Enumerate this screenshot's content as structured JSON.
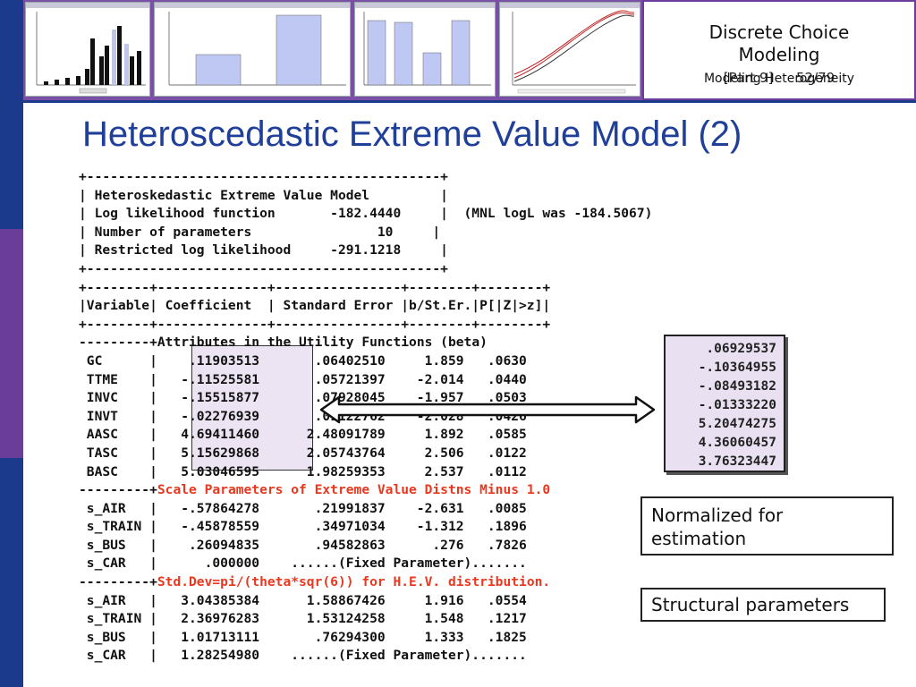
{
  "colors": {
    "sidebar_blue": "#1c3a8c",
    "sidebar_purple": "#6a3d9a",
    "band_purple": "#7a4fa5",
    "title_blue": "#1f3f99",
    "highlight_red": "#e8381f",
    "box_fill": "#e9e1f1"
  },
  "header": {
    "course_title_line1": "Discrete Choice",
    "course_title_line2": "Modeling",
    "part_label": "[Part 9]",
    "page": "52/79",
    "subtitle": "Modeling Heterogeneity"
  },
  "slide": {
    "title": "Heteroscedastic Extreme Value Model (2)"
  },
  "output_lines": [
    {
      "text": "+---------------------------------------------+"
    },
    {
      "text": "| Heteroskedastic Extreme Value Model         |"
    },
    {
      "text": "| Log likelihood function       -182.4440     |  (MNL logL was -184.5067)"
    },
    {
      "text": "| Number of parameters                10     |"
    },
    {
      "text": "| Restricted log likelihood     -291.1218     |"
    },
    {
      "text": "+---------------------------------------------+"
    },
    {
      "text": "+--------+--------------+----------------+--------+--------+"
    },
    {
      "text": "|Variable| Coefficient  | Standard Error |b/St.Er.|P[|Z|>z]|"
    },
    {
      "text": "+--------+--------------+----------------+--------+--------+"
    },
    {
      "prefix": "---------+",
      "text": "Attributes in the Utility Functions (beta)"
    },
    {
      "text": " GC      |    .11903513       .06402510     1.859   .0630"
    },
    {
      "text": " TTME    |   -.11525581       .05721397    -2.014   .0440"
    },
    {
      "text": " INVC    |   -.15515877       .07928045    -1.957   .0503"
    },
    {
      "text": " INVT    |   -.02276939       .01122762    -2.028   .0426"
    },
    {
      "text": " AASC    |   4.69411460      2.48091789     1.892   .0585"
    },
    {
      "text": " TASC    |   5.15629868      2.05743764     2.506   .0122"
    },
    {
      "text": " BASC    |   5.03046595      1.98259353     2.537   .0112"
    },
    {
      "prefix": "---------+",
      "red": "Scale Parameters of Extreme Value Distns Minus 1.0"
    },
    {
      "text": " s_AIR   |   -.57864278       .21991837    -2.631   .0085"
    },
    {
      "text": " s_TRAIN |   -.45878559       .34971034    -1.312   .1896"
    },
    {
      "text": " s_BUS   |    .26094835       .94582863      .276   .7826"
    },
    {
      "text": " s_CAR   |      .000000    ......(Fixed Parameter)......."
    },
    {
      "prefix": "---------+",
      "red": "Std.Dev=pi/(theta*sqr(6)) for H.E.V. distribution."
    },
    {
      "text": " s_AIR   |   3.04385384      1.58867426     1.916   .0554"
    },
    {
      "text": " s_TRAIN |   2.36976283      1.53124258     1.548   .1217"
    },
    {
      "text": " s_BUS   |   1.01713111       .76294300     1.333   .1825"
    },
    {
      "text": " s_CAR   |   1.28254980    ......(Fixed Parameter)......."
    }
  ],
  "normalized_values": [
    ".06929537",
    "-.10364955",
    "-.08493182",
    "-.01333220",
    "5.20474275",
    "4.36060457",
    "3.76323447"
  ],
  "notes": {
    "normalized": "Normalized for estimation",
    "structural": "Structural parameters"
  },
  "thumbnails": [
    {
      "name": "histogram-thumb"
    },
    {
      "name": "bar-chart-thumb-1"
    },
    {
      "name": "bar-chart-thumb-2"
    },
    {
      "name": "line-chart-thumb"
    }
  ]
}
